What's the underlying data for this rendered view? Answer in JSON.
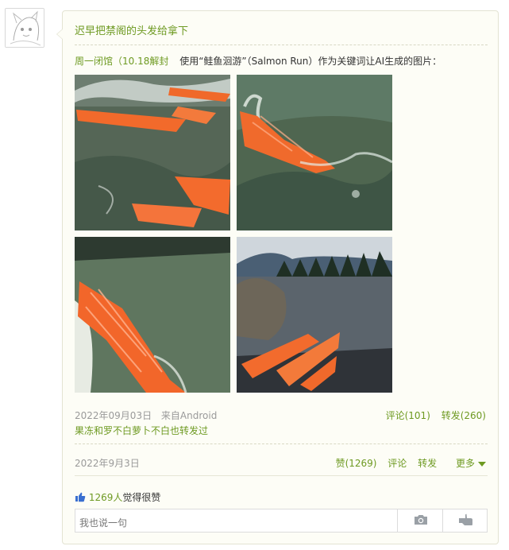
{
  "post": {
    "title": "迟早把禁阁的头发给拿下",
    "author": "周一闭馆（10.18解封",
    "text": "使用“鲑鱼洄游”（Salmon Run）作为关键词让AI生成的图片：",
    "date": "2022年09月03日",
    "source": "来自Android",
    "comments_label": "评论(101)",
    "reposts_label": "转发(260)",
    "repost_note": "果冻和罗不白萝卜不白也转发过"
  },
  "footer": {
    "date": "2022年9月3日",
    "like_label": "赞(1269)",
    "comment_label": "评论",
    "repost_label": "转发",
    "more_label": "更多"
  },
  "likes": {
    "count": "1269人",
    "suffix": "觉得很赞"
  },
  "comment_input": {
    "placeholder": "我也说一句"
  },
  "icons": [
    "thumbs-up-icon",
    "camera-icon",
    "hand-point-icon",
    "chevron-down-icon"
  ],
  "colors": {
    "accent": "#6e9a22",
    "meta": "#9a9a9a",
    "salmon": "#f06a2a",
    "water": "#4b5e50"
  }
}
